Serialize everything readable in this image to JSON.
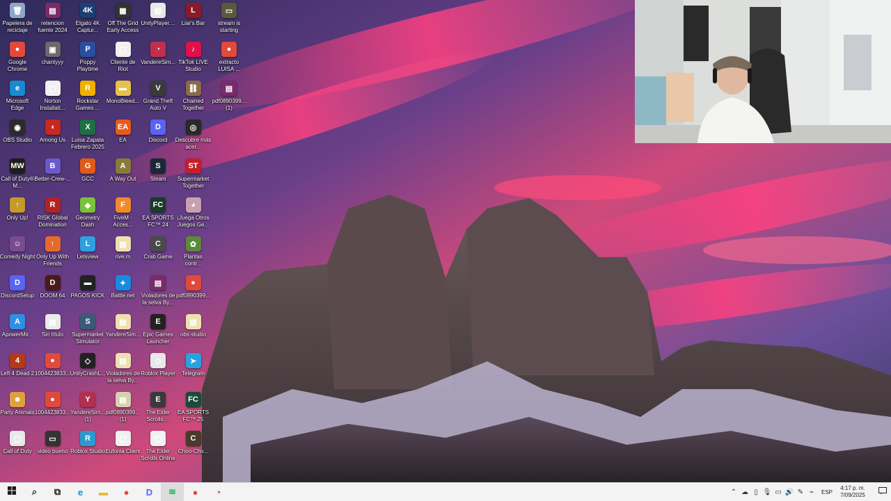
{
  "desktop": {
    "columns": [
      [
        {
          "label": "Papelera de reciclaje",
          "icon": "recycle-bin-icon",
          "color": "#8fa7c7",
          "glyph": "🗑"
        },
        {
          "label": "Google Chrome",
          "icon": "chrome-icon",
          "color": "#e04a3a",
          "glyph": "●"
        },
        {
          "label": "Microsoft Edge",
          "icon": "edge-icon",
          "color": "#1a8ad0",
          "glyph": "e"
        },
        {
          "label": "OBS Studio",
          "icon": "obs-icon",
          "color": "#2b2b2b",
          "glyph": "◉"
        },
        {
          "label": "Call of Duty® M...",
          "icon": "cod-icon",
          "color": "#1d1d1d",
          "glyph": "MW"
        },
        {
          "label": "Only Up!",
          "icon": "only-up-icon",
          "color": "#c49a2a",
          "glyph": "↑"
        },
        {
          "label": "Comedy Night",
          "icon": "comedy-night-icon",
          "color": "#7a4b8f",
          "glyph": "☺"
        },
        {
          "label": "DiscordSetup",
          "icon": "discord-setup-icon",
          "color": "#5865f2",
          "glyph": "D"
        },
        {
          "label": "ApowerMir...",
          "icon": "apowermirror-icon",
          "color": "#2f8fe0",
          "glyph": "A"
        },
        {
          "label": "Left 4 Dead 2",
          "icon": "left4dead-icon",
          "color": "#b13a1a",
          "glyph": "4"
        },
        {
          "label": "Party Animals",
          "icon": "party-animals-icon",
          "color": "#e0a040",
          "glyph": "☻"
        },
        {
          "label": "Call of Duty",
          "icon": "cod-file-icon",
          "color": "#e8e8e8",
          "glyph": "▢"
        }
      ],
      [
        {
          "label": "retencion fuente 2024",
          "icon": "winrar-icon",
          "color": "#7a2b6c",
          "glyph": "▤"
        },
        {
          "label": "chantyyy",
          "icon": "folder-image-icon",
          "color": "#6a6a6a",
          "glyph": "▣"
        },
        {
          "label": "Norton Installati...",
          "icon": "norton-icon",
          "color": "#f0f0f0",
          "glyph": "▢"
        },
        {
          "label": "Among Us",
          "icon": "among-us-icon",
          "color": "#c8281e",
          "glyph": "◖"
        },
        {
          "label": "Better-Crew-...",
          "icon": "better-crew-icon",
          "color": "#6a5acd",
          "glyph": "B"
        },
        {
          "label": "RISK Global Domination",
          "icon": "risk-icon",
          "color": "#b22222",
          "glyph": "R"
        },
        {
          "label": "Only Up With Friends",
          "icon": "only-up-friends-icon",
          "color": "#e86a2a",
          "glyph": "↑"
        },
        {
          "label": "DOOM 64",
          "icon": "doom-icon",
          "color": "#4a1a1a",
          "glyph": "D"
        },
        {
          "label": "Sin título",
          "icon": "text-file-icon",
          "color": "#eaeaea",
          "glyph": "▤"
        },
        {
          "label": "1004423833...",
          "icon": "chrome-file-icon",
          "color": "#e04a3a",
          "glyph": "●"
        },
        {
          "label": "1004423833...",
          "icon": "chrome-file-icon",
          "color": "#e04a3a",
          "glyph": "●"
        },
        {
          "label": "video bueno",
          "icon": "video-icon",
          "color": "#333",
          "glyph": "▭"
        }
      ],
      [
        {
          "label": "Elgato 4K Captur...",
          "icon": "elgato-icon",
          "color": "#1c3f73",
          "glyph": "4K"
        },
        {
          "label": "Poppy Playtime",
          "icon": "poppy-icon",
          "color": "#2a4fa0",
          "glyph": "P"
        },
        {
          "label": "Rockstar Games ...",
          "icon": "rockstar-icon",
          "color": "#f0b000",
          "glyph": "R"
        },
        {
          "label": "Luisa Zapata Febrero 2025",
          "icon": "excel-icon",
          "color": "#1d7044",
          "glyph": "X"
        },
        {
          "label": "GCC",
          "icon": "gcc-icon",
          "color": "#e05a1a",
          "glyph": "G"
        },
        {
          "label": "Geometry Dash",
          "icon": "geometry-dash-icon",
          "color": "#7ac23a",
          "glyph": "◆"
        },
        {
          "label": "Letsview",
          "icon": "letsview-icon",
          "color": "#2fa0e0",
          "glyph": "L"
        },
        {
          "label": "PAGOS KICK",
          "icon": "folder-dark-icon",
          "color": "#222",
          "glyph": "▬"
        },
        {
          "label": "Supermarket Simulator",
          "icon": "supermarket-icon",
          "color": "#3a5a7a",
          "glyph": "S"
        },
        {
          "label": "UnityCrashL...",
          "icon": "unity-icon",
          "color": "#222",
          "glyph": "◇"
        },
        {
          "label": "YandereSim... (1)",
          "icon": "yandere-icon",
          "color": "#b03050",
          "glyph": "Y"
        },
        {
          "label": "Roblox Studio",
          "icon": "roblox-studio-icon",
          "color": "#2a9ad0",
          "glyph": "R"
        }
      ],
      [
        {
          "label": "Off The Grid Early Access",
          "icon": "off-the-grid-icon",
          "color": "#333",
          "glyph": "▦"
        },
        {
          "label": "Cliente de Riot",
          "icon": "riot-file-icon",
          "color": "#f0f0f0",
          "glyph": "▢"
        },
        {
          "label": "MonoBleed...",
          "icon": "folder-icon",
          "color": "#e8c14a",
          "glyph": "▬"
        },
        {
          "label": "EA",
          "icon": "ea-icon",
          "color": "#e85a1a",
          "glyph": "EA"
        },
        {
          "label": "A Way Out",
          "icon": "a-way-out-icon",
          "color": "#8a7a3a",
          "glyph": "A"
        },
        {
          "label": "FiveM - Acces...",
          "icon": "fivem-icon",
          "color": "#f08a2a",
          "glyph": "F"
        },
        {
          "label": "rive.m",
          "icon": "file-icon",
          "color": "#eee0b0",
          "glyph": "▤"
        },
        {
          "label": "Battle.net",
          "icon": "battlenet-icon",
          "color": "#1a8ae0",
          "glyph": "✦"
        },
        {
          "label": "YandereSim...",
          "icon": "file-icon",
          "color": "#eee0b0",
          "glyph": "▤"
        },
        {
          "label": "Violadores de la selva By...",
          "icon": "file-icon",
          "color": "#eee0b0",
          "glyph": "▤"
        },
        {
          "label": "pdf0890399... (1)",
          "icon": "file-icon",
          "color": "#d8d0b0",
          "glyph": "▤"
        },
        {
          "label": "Eufonia Client",
          "icon": "eufonia-icon",
          "color": "#f0f0f0",
          "glyph": "▢"
        }
      ],
      [
        {
          "label": "UnityPlayer....",
          "icon": "file-icon",
          "color": "#e8e8e8",
          "glyph": "▤"
        },
        {
          "label": "VandereSim...",
          "icon": "yandere-exe-icon",
          "color": "#c0304a",
          "glyph": "◔"
        },
        {
          "label": "Grand Theft Auto V",
          "icon": "gta-icon",
          "color": "#3a3a3a",
          "glyph": "V"
        },
        {
          "label": "Discord",
          "icon": "discord-icon",
          "color": "#5865f2",
          "glyph": "D"
        },
        {
          "label": "Steam",
          "icon": "steam-icon",
          "color": "#1b2838",
          "glyph": "S"
        },
        {
          "label": "EA SPORTS FC™ 24",
          "icon": "fc24-icon",
          "color": "#1a3a2a",
          "glyph": "FC"
        },
        {
          "label": "Crab Game",
          "icon": "crab-game-icon",
          "color": "#4a4a4a",
          "glyph": "C"
        },
        {
          "label": "Violadores de la selva By...",
          "icon": "winrar-icon",
          "color": "#7a2b6c",
          "glyph": "▤"
        },
        {
          "label": "Epic Games Launcher",
          "icon": "epic-icon",
          "color": "#222",
          "glyph": "E"
        },
        {
          "label": "Roblox Player",
          "icon": "roblox-icon",
          "color": "#e8e8e8",
          "glyph": "◇"
        },
        {
          "label": "The Elder Scrolls ...",
          "icon": "elder-scrolls-icon",
          "color": "#3a3a3a",
          "glyph": "E"
        },
        {
          "label": "The Elder Scrolls Online",
          "icon": "eso-icon",
          "color": "#f0f0f0",
          "glyph": "▢"
        }
      ],
      [
        {
          "label": "Liar's Bar",
          "icon": "liars-bar-icon",
          "color": "#8a1a2a",
          "glyph": "L"
        },
        {
          "label": "TikTok LIVE Studio",
          "icon": "tiktok-icon",
          "color": "#e0104a",
          "glyph": "♪"
        },
        {
          "label": "Chained Together",
          "icon": "chained-together-icon",
          "color": "#8a6a4a",
          "glyph": "⛓"
        },
        {
          "label": "Descubre más acer...",
          "icon": "discover-icon",
          "color": "#2a2a2a",
          "glyph": "◎"
        },
        {
          "label": "Supermarket Together",
          "icon": "supermarket-together-icon",
          "color": "#c0202a",
          "glyph": "ST"
        },
        {
          "label": "¡Juega Otros Juegos Ge...",
          "icon": "play-games-icon",
          "color": "#c8a0b0",
          "glyph": "◕"
        },
        {
          "label": "Plantas contr...",
          "icon": "pvz-icon",
          "color": "#5a8a3a",
          "glyph": "✿"
        },
        {
          "label": "pdf0890399...",
          "icon": "chrome-file-icon",
          "color": "#e04a3a",
          "glyph": "●"
        },
        {
          "label": "obs-studio",
          "icon": "file-icon",
          "color": "#eee0b0",
          "glyph": "▤"
        },
        {
          "label": "Telegram",
          "icon": "telegram-icon",
          "color": "#2aa0e0",
          "glyph": "➤"
        },
        {
          "label": "EA SPORTS FC™ 25",
          "icon": "fc25-icon",
          "color": "#1a4a3a",
          "glyph": "FC"
        },
        {
          "label": "Choo-Cho...",
          "icon": "choo-choo-icon",
          "color": "#4a3a2a",
          "glyph": "C"
        }
      ]
    ],
    "extra_column": [
      {
        "label": "stream is starting",
        "icon": "stream-file-icon",
        "color": "#5a5a3a",
        "glyph": "▭"
      },
      {
        "label": "extracto LUISA ...",
        "icon": "chrome-file-icon",
        "color": "#e04a3a",
        "glyph": "●"
      },
      {
        "label": "pdf0890399... (1)",
        "icon": "winrar-icon",
        "color": "#7a2b6c",
        "glyph": "▤"
      }
    ]
  },
  "taskbar": {
    "start_icon": "windows-start-icon",
    "pinned": [
      {
        "name": "search-icon",
        "glyph": "⌕",
        "color": "#222"
      },
      {
        "name": "task-view-icon",
        "glyph": "⧉",
        "color": "#222"
      },
      {
        "name": "edge-icon",
        "glyph": "e",
        "color": "#1a8ad0"
      },
      {
        "name": "file-explorer-icon",
        "glyph": "▬",
        "color": "#e8b830"
      },
      {
        "name": "chrome-icon",
        "glyph": "●",
        "color": "#e04a3a"
      },
      {
        "name": "discord-icon",
        "glyph": "D",
        "color": "#5865f2"
      },
      {
        "name": "spotify-icon",
        "glyph": "≋",
        "color": "#1db954"
      },
      {
        "name": "chrome-profile-icon",
        "glyph": "●",
        "color": "#e04a3a"
      },
      {
        "name": "yandere-icon",
        "glyph": "◔",
        "color": "#c0304a"
      }
    ],
    "language": "ESP",
    "time": "4:17 p. m.",
    "date": "7/09/2025"
  }
}
